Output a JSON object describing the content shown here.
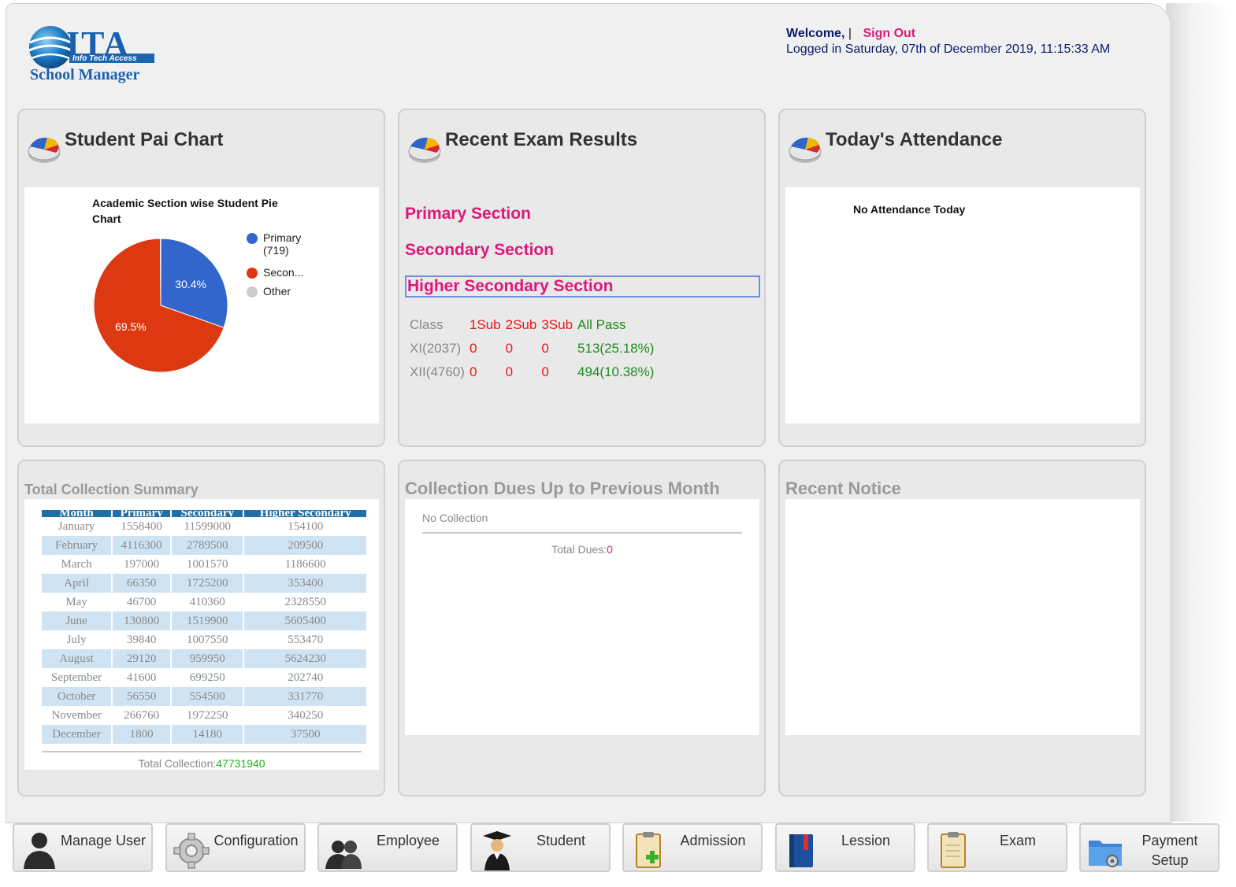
{
  "header": {
    "logo_main": "ITA",
    "logo_sub": "Info Tech Access",
    "logo_product": "School Manager",
    "welcome_label": "Welcome,",
    "separator": "|",
    "sign_out": "Sign Out",
    "logged_in": "Logged in Saturday, 07th of December 2019, 11:15:33 AM"
  },
  "student_chart_panel": {
    "title": "Student Pai Chart",
    "chart_data": {
      "type": "pie",
      "title": "Academic Section wise Student Pie Chart",
      "slices": [
        {
          "name": "Primary",
          "legend_label": "Primary",
          "legend_value": "(719)",
          "percent": 30.4,
          "label": "30.4%",
          "color": "#3366cc"
        },
        {
          "name": "Secondary",
          "legend_label": "Secon...",
          "percent": 69.5,
          "label": "69.5%",
          "color": "#dc3912"
        },
        {
          "name": "Other",
          "legend_label": "Other",
          "percent": 0.1,
          "label": "",
          "color": "#cccccc"
        }
      ],
      "legend_position": "right"
    }
  },
  "exam_panel": {
    "title": "Recent Exam Results",
    "sections": [
      "Primary Section",
      "Secondary Section",
      "Higher Secondary Section"
    ],
    "table_headers": [
      "Class",
      "1Sub",
      "2Sub",
      "3Sub",
      "All Pass"
    ],
    "rows": [
      [
        "XI(2037)",
        "0",
        "0",
        "0",
        "513(25.18%)"
      ],
      [
        "XII(4760)",
        "0",
        "0",
        "0",
        "494(10.38%)"
      ]
    ]
  },
  "attendance_panel": {
    "title": "Today's Attendance",
    "message": "No Attendance Today"
  },
  "collection_panel": {
    "title": "Total Collection Summary",
    "headers": [
      "Month",
      "Primary",
      "Secondary",
      "Higher Secondary"
    ],
    "rows": [
      [
        "January",
        "1558400",
        "11599000",
        "154100"
      ],
      [
        "February",
        "4116300",
        "2789500",
        "209500"
      ],
      [
        "March",
        "197000",
        "1001570",
        "1186600"
      ],
      [
        "April",
        "66350",
        "1725200",
        "353400"
      ],
      [
        "May",
        "46700",
        "410360",
        "2328550"
      ],
      [
        "June",
        "130800",
        "1519900",
        "5605400"
      ],
      [
        "July",
        "39840",
        "1007550",
        "553470"
      ],
      [
        "August",
        "29120",
        "959950",
        "5624230"
      ],
      [
        "September",
        "41600",
        "699250",
        "202740"
      ],
      [
        "October",
        "56550",
        "554500",
        "331770"
      ],
      [
        "November",
        "266760",
        "1972250",
        "340250"
      ],
      [
        "December",
        "1800",
        "14180",
        "37500"
      ]
    ],
    "total_label": "Total Collection:",
    "total_value": "47731940"
  },
  "dues_panel": {
    "title": "Collection Dues Up to Previous Month",
    "message": "No Collection",
    "total_label": "Total Dues:",
    "total_value": "0"
  },
  "notice_panel": {
    "title": "Recent Notice"
  },
  "nav": [
    {
      "label": "Manage User",
      "icon": "user-icon"
    },
    {
      "label": "Configuration",
      "icon": "gear-icon"
    },
    {
      "label": "Employee",
      "icon": "users-icon"
    },
    {
      "label": "Student",
      "icon": "graduate-icon"
    },
    {
      "label": "Admission",
      "icon": "clipboard-add-icon"
    },
    {
      "label": "Lession",
      "icon": "book-icon"
    },
    {
      "label": "Exam",
      "icon": "clipboard-icon"
    },
    {
      "label": "Payment Setup",
      "icon": "folder-gear-icon"
    }
  ],
  "colors": {
    "accent_pink": "#e0177a",
    "header_navy": "#0b1a6b",
    "table_header_blue": "#1f6fa8",
    "table_alt_row": "#cfe3f3",
    "pass_green": "#1f8a1f",
    "fail_red": "#e81818"
  }
}
